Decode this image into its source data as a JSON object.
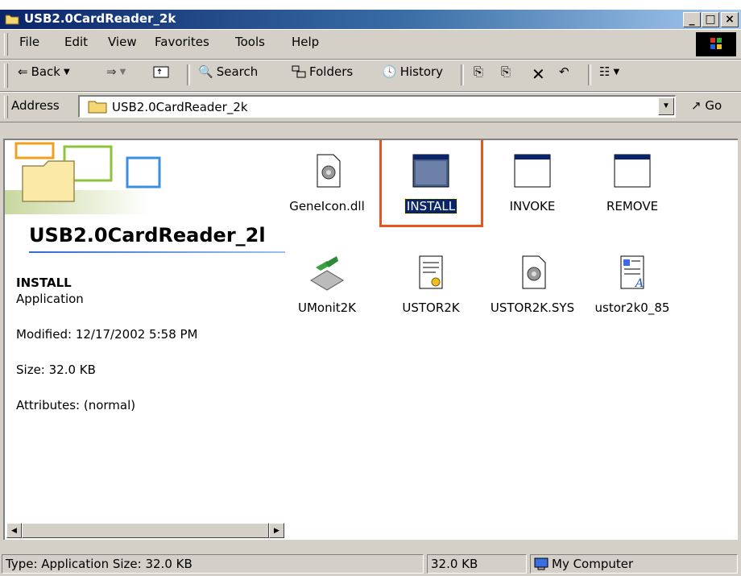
{
  "window": {
    "title": "USB2.0CardReader_2k"
  },
  "menu": [
    "File",
    "Edit",
    "View",
    "Favorites",
    "Tools",
    "Help"
  ],
  "toolbar": {
    "back": "Back",
    "search": "Search",
    "folders": "Folders",
    "history": "History"
  },
  "address": {
    "label": "Address",
    "value": "USB2.0CardReader_2k",
    "go": "Go"
  },
  "sidebar": {
    "folder_title": "USB2.0CardReader_2l",
    "selected_name": "INSTALL",
    "selected_type": "Application",
    "modified": "Modified: 12/17/2002 5:58 PM",
    "size": "Size: 32.0 KB",
    "attributes": "Attributes: (normal)"
  },
  "files": [
    {
      "name": "GeneIcon.dll",
      "icon": "dll-icon"
    },
    {
      "name": "INSTALL",
      "icon": "application-icon",
      "selected": true
    },
    {
      "name": "INVOKE",
      "icon": "application-icon"
    },
    {
      "name": "REMOVE",
      "icon": "application-icon"
    },
    {
      "name": "UMonit2K",
      "icon": "monitor-app-icon"
    },
    {
      "name": "USTOR2K",
      "icon": "setup-info-icon"
    },
    {
      "name": "USTOR2K.SYS",
      "icon": "system-file-icon"
    },
    {
      "name": "ustor2k0_85",
      "icon": "document-icon"
    }
  ],
  "status": {
    "type_size": "Type: Application Size: 32.0 KB",
    "size": "32.0 KB",
    "location": "My Computer"
  },
  "colors": {
    "selection": "#0a246a",
    "highlight_box": "#e8541c",
    "titlebar": "#0a246a"
  }
}
